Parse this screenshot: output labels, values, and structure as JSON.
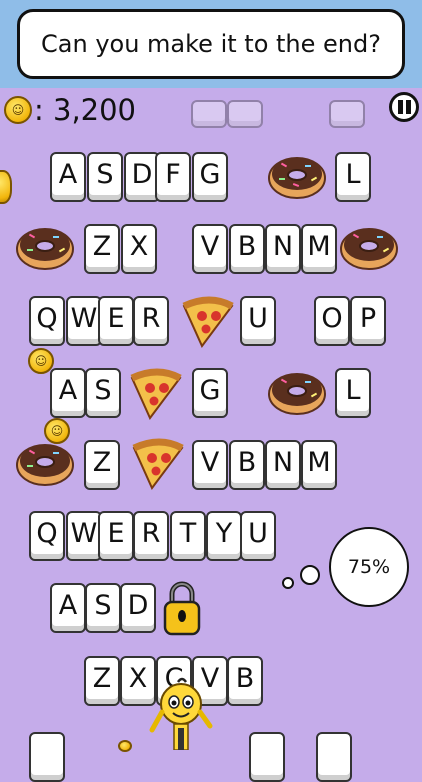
{
  "header": {
    "title": "Can you make it to the end?"
  },
  "score": {
    "value": ": 3,200",
    "icon": "coin-icon"
  },
  "progress": {
    "text": "75%"
  },
  "colors": {
    "sky": "#8fbde8",
    "background": "#c5acea",
    "coin": "#f2b60c",
    "donut_frosting": "#5a2f1e"
  },
  "keys": [
    {
      "id": "r1-a",
      "label": "A"
    },
    {
      "id": "r1-s",
      "label": "S"
    },
    {
      "id": "r1-d",
      "label": "D"
    },
    {
      "id": "r1-f",
      "label": "F"
    },
    {
      "id": "r1-g",
      "label": "G"
    },
    {
      "id": "r1-l",
      "label": "L"
    },
    {
      "id": "r2-z",
      "label": "Z"
    },
    {
      "id": "r2-x",
      "label": "X"
    },
    {
      "id": "r2-v",
      "label": "V"
    },
    {
      "id": "r2-b",
      "label": "B"
    },
    {
      "id": "r2-n",
      "label": "N"
    },
    {
      "id": "r2-m",
      "label": "M"
    },
    {
      "id": "r3-q",
      "label": "Q"
    },
    {
      "id": "r3-w",
      "label": "W"
    },
    {
      "id": "r3-e",
      "label": "E"
    },
    {
      "id": "r3-r",
      "label": "R"
    },
    {
      "id": "r3-u",
      "label": "U"
    },
    {
      "id": "r3-o",
      "label": "O"
    },
    {
      "id": "r3-p",
      "label": "P"
    },
    {
      "id": "r4-a",
      "label": "A"
    },
    {
      "id": "r4-s",
      "label": "S"
    },
    {
      "id": "r4-g",
      "label": "G"
    },
    {
      "id": "r4-l",
      "label": "L"
    },
    {
      "id": "r5-z",
      "label": "Z"
    },
    {
      "id": "r5-v",
      "label": "V"
    },
    {
      "id": "r5-b",
      "label": "B"
    },
    {
      "id": "r5-n",
      "label": "N"
    },
    {
      "id": "r5-m",
      "label": "M"
    },
    {
      "id": "r6-q",
      "label": "Q"
    },
    {
      "id": "r6-w",
      "label": "W"
    },
    {
      "id": "r6-e",
      "label": "E"
    },
    {
      "id": "r6-r",
      "label": "R"
    },
    {
      "id": "r6-t",
      "label": "T"
    },
    {
      "id": "r6-y",
      "label": "Y"
    },
    {
      "id": "r6-u",
      "label": "U"
    },
    {
      "id": "r7-a",
      "label": "A"
    },
    {
      "id": "r7-s",
      "label": "S"
    },
    {
      "id": "r7-d",
      "label": "D"
    },
    {
      "id": "r8-z",
      "label": "Z"
    },
    {
      "id": "r8-x",
      "label": "X"
    },
    {
      "id": "r8-c",
      "label": "C"
    },
    {
      "id": "r8-v",
      "label": "V"
    },
    {
      "id": "r8-b",
      "label": "B"
    }
  ]
}
